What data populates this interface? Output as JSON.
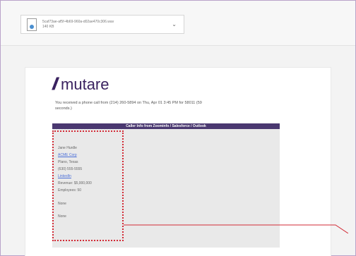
{
  "attachment": {
    "filename": "5caf73ae-af5f-4b69-960a-d02ae470c306.wav",
    "size": "140 KB",
    "icon": "audio-file-icon",
    "chevron": "⌄"
  },
  "email": {
    "logo_mark": "///",
    "logo_text": "mutare",
    "intro": "You received a phone call from (214) 260-5894 on Thu, Apr 01 3:45 PM for 58011 (59 seconds.)"
  },
  "caller_info": {
    "header": "Caller Info from Zoominfo / Salesforce / Outlook",
    "items": [
      {
        "text": "Jane Hurdle",
        "link": false
      },
      {
        "text": "ACME Corp",
        "link": true
      },
      {
        "text": "Plano, Texas",
        "link": false
      },
      {
        "text": "(630) 555-5555",
        "link": false
      },
      {
        "text": "LinkedIn",
        "link": true
      },
      {
        "text": "Revenue: $5,000,000",
        "link": false
      },
      {
        "text": "Employees: 50",
        "link": false
      },
      {
        "text": "None",
        "link": false
      },
      {
        "text": "None",
        "link": false
      }
    ]
  },
  "colors": {
    "brand": "#3a2260",
    "header_bar": "#4a3870",
    "highlight": "#d22a35",
    "link": "#4a6ed8"
  }
}
